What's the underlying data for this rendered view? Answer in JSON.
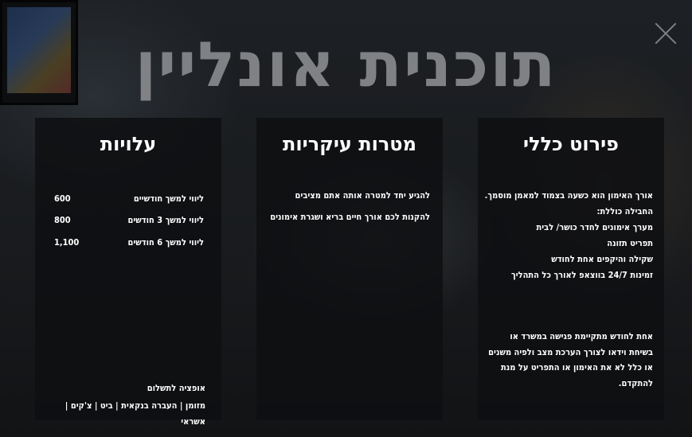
{
  "page": {
    "title": "תוכנית אונליין",
    "close_icon": "close-icon"
  },
  "costs": {
    "heading": "עלויות",
    "rows": [
      {
        "label": "ליווי למשך חודשיים",
        "price": "600"
      },
      {
        "label": "ליווי למשך 3 חודשים",
        "price": "800"
      },
      {
        "label": "ליווי למשך 6 חודשים",
        "price": "1,100"
      }
    ],
    "payment_title": "אופציה לתשלום",
    "payment_methods": "מזומן | העברה בנקאית | ביט | צ'קים | אשראי"
  },
  "goals": {
    "heading": "מטרות עיקריות",
    "items": [
      "להגיע יחד למטרה אותה אתם מציבים",
      "להקנות לכם אורך חיים בריא ושגרת אימונים"
    ]
  },
  "overview": {
    "heading": "פירוט כללי",
    "lines": [
      "אורך האימון הוא כשעה בצמוד למאמן מוסמך.",
      "החבילה כוללת:",
      "מערך אימונים לחדר כושר/ לבית",
      "תפריט תזונה",
      "שקילה והיקפים אחת לחודש",
      "זמינות 24/7 בווצאפ לאורך כל התהליך"
    ],
    "paragraph": "אחת לחודש מתקיימת פגישה במשרד או בשיחת וידאו לצורך הערכת מצב ולפיה משנים או כלל לא את האימון או התפריט על מנת להתקדם."
  }
}
